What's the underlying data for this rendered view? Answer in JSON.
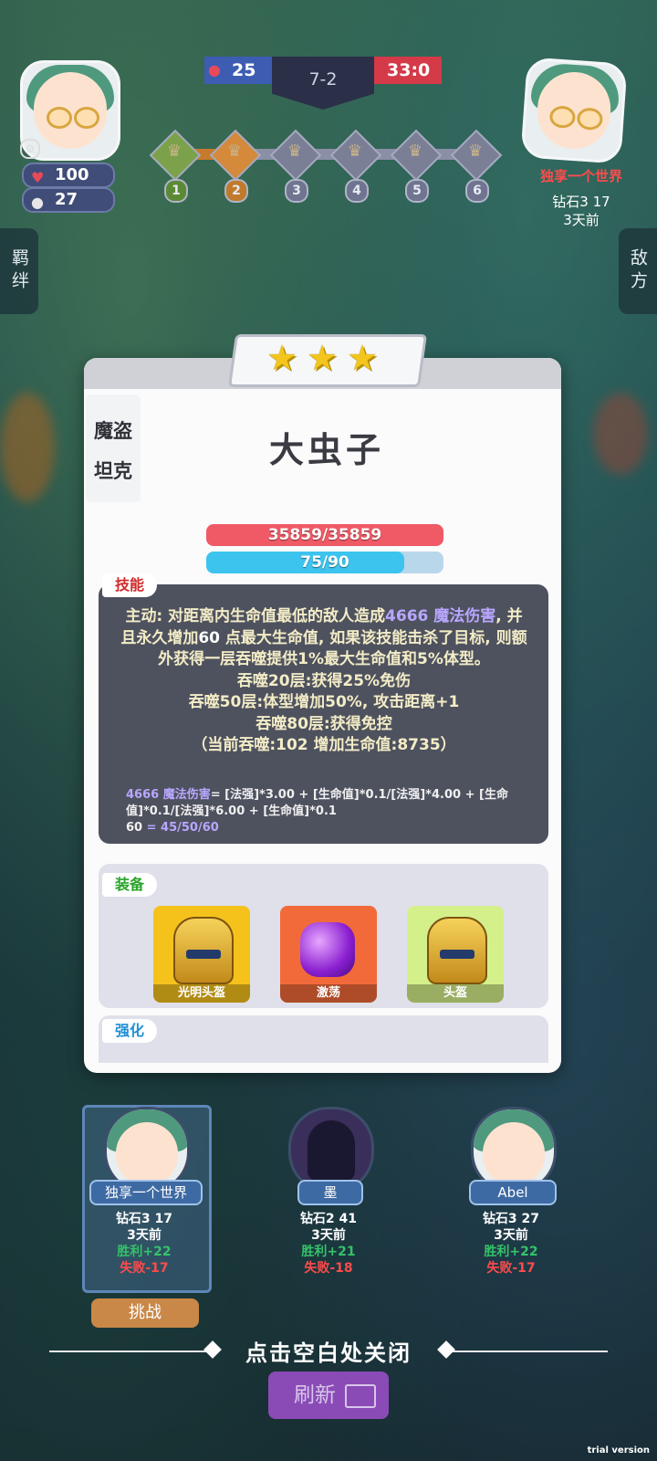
{
  "player": {
    "hp": "100",
    "coins": "27"
  },
  "scoreboard": {
    "left_score": "25",
    "round": "7-2",
    "right_score": "33:0"
  },
  "stages": [
    "1",
    "2",
    "3",
    "4",
    "5",
    "6"
  ],
  "opponent_header": {
    "name": "独享一个世界",
    "rank": "钻石3 17",
    "time": "3天前"
  },
  "side_tabs": {
    "left": "羁绊",
    "right": "敌方"
  },
  "unit": {
    "stars": 3,
    "name": "大虫子",
    "traits": [
      "魔盗",
      "坦克"
    ],
    "hp": "35859/35859",
    "hp_fraction": 1.0,
    "mana": "75/90",
    "mana_fraction": 0.8333
  },
  "skill": {
    "tag": "技能",
    "p1_a": "主动: 对距离内生命值最低的敌人造成",
    "p1_dmg": "4666 魔法伤害",
    "p1_b": ", 并且永久增加",
    "p1_hp": "60",
    "p1_c": " 点最大生命值, 如果该技能击杀了目标, 则额外获得一层吞噬提供1%最大生命值和5%体型。",
    "line2": "吞噬20层:获得25%免伤",
    "line3": "吞噬50层:体型增加50%, 攻击距离+1",
    "line4": "吞噬80层:获得免控",
    "line5": "（当前吞噬:102 增加生命值:8735）",
    "formula1_hl": "4666 魔法伤害",
    "formula1": "= [法强]*3.00 + [生命值]*0.1/[法强]*4.00 + [生命值]*0.1/[法强]*6.00 + [生命值]*0.1",
    "formula2_hl": "60",
    "formula2": " = 45/50/60"
  },
  "equipment": {
    "tag": "装备",
    "items": [
      {
        "label": "光明头盔",
        "icon": "golden-helmet-icon",
        "bg": "#f5c21c"
      },
      {
        "label": "激荡",
        "icon": "purple-orb-icon",
        "bg": "#f26a3a"
      },
      {
        "label": "头盔",
        "icon": "golden-helmet-icon",
        "bg": "#d4f08a"
      }
    ]
  },
  "upgrade": {
    "tag": "强化"
  },
  "opponents": [
    {
      "name": "独享一个世界",
      "rank": "钻石3 17",
      "time": "3天前",
      "wins": "胜利+22",
      "losses": "失败-17"
    },
    {
      "name": "墨",
      "rank": "钻石2 41",
      "time": "3天前",
      "wins": "胜利+21",
      "losses": "失败-18"
    },
    {
      "name": "Abel",
      "rank": "钻石3 27",
      "time": "3天前",
      "wins": "胜利+22",
      "losses": "失败-17"
    }
  ],
  "buttons": {
    "challenge": "挑战",
    "close_hint": "点击空白处关闭",
    "refresh": "刷新"
  },
  "watermark": "trial version",
  "colors": {
    "hp_bar": "#ef5a66",
    "mana_bar": "#3cc4ee",
    "mana_track": "#b9d7ea",
    "skill_panel": "#4e525f",
    "accent_red": "#ff4b4b"
  }
}
